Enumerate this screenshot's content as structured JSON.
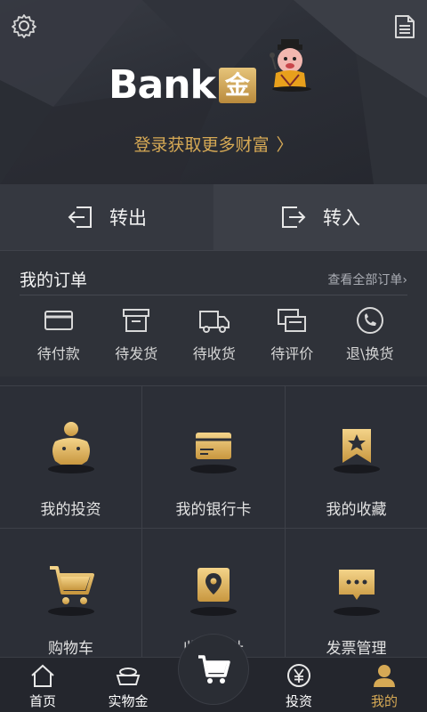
{
  "header": {
    "logo_text": "Bank",
    "logo_gold": "金",
    "login_link": "登录获取更多财富",
    "login_chevron": "〉"
  },
  "transfer": {
    "out_label": "转出",
    "in_label": "转入"
  },
  "orders": {
    "title": "我的订单",
    "view_all": "查看全部订单",
    "view_all_chevron": "›",
    "items": [
      {
        "label": "待付款",
        "icon": "card-icon"
      },
      {
        "label": "待发货",
        "icon": "box-icon"
      },
      {
        "label": "待收货",
        "icon": "truck-icon"
      },
      {
        "label": "待评价",
        "icon": "chat-icon"
      },
      {
        "label": "退\\换货",
        "icon": "phone-icon"
      }
    ]
  },
  "grid": {
    "items": [
      {
        "label": "我的投资",
        "icon": "piggy-bank-icon"
      },
      {
        "label": "我的银行卡",
        "icon": "bank-card-icon"
      },
      {
        "label": "我的收藏",
        "icon": "bookmark-star-icon"
      },
      {
        "label": "购物车",
        "icon": "cart-icon"
      },
      {
        "label": "收货地址",
        "icon": "location-pin-icon"
      },
      {
        "label": "发票管理",
        "icon": "invoice-message-icon"
      }
    ]
  },
  "nav": {
    "items": [
      {
        "label": "首页",
        "icon": "home-icon"
      },
      {
        "label": "实物金",
        "icon": "gold-ingot-icon"
      },
      {
        "label": "投资",
        "icon": "yen-circle-icon"
      },
      {
        "label": "我的",
        "icon": "user-icon"
      }
    ],
    "center_icon": "cart-icon"
  },
  "colors": {
    "accent_gold": "#d6a955",
    "background": "#2b2e36"
  }
}
